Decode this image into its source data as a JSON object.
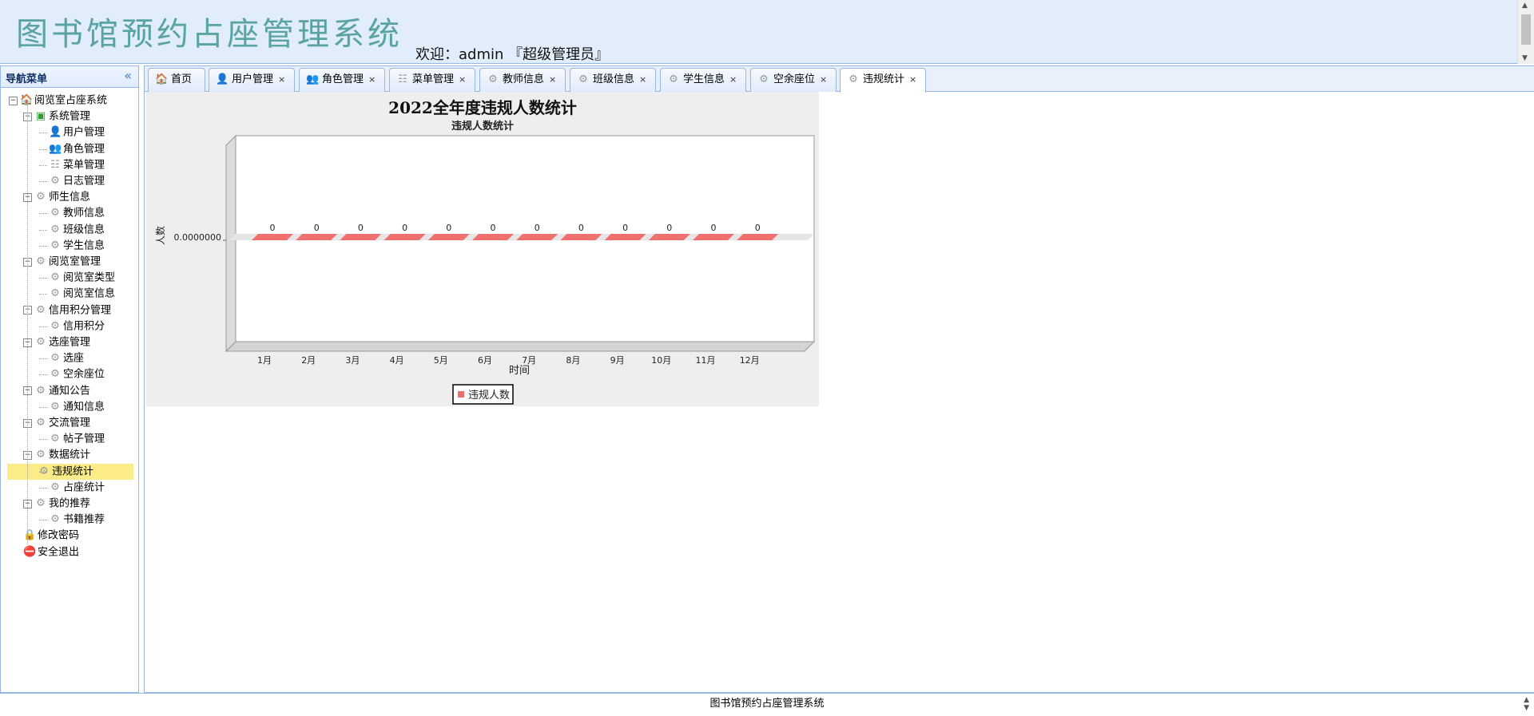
{
  "header": {
    "title": "图书馆预约占座管理系统",
    "welcome": "欢迎：admin 『超级管理员』"
  },
  "sidebar": {
    "title": "导航菜单",
    "tree": [
      {
        "label": "阅览室占座系统",
        "icon": "home-icon",
        "level": 0,
        "toggle": "⊟"
      },
      {
        "label": "系统管理",
        "icon": "green-square-icon",
        "level": 1,
        "toggle": "⊟"
      },
      {
        "label": "用户管理",
        "icon": "user-icon",
        "level": 2
      },
      {
        "label": "角色管理",
        "icon": "role-icon",
        "level": 2
      },
      {
        "label": "菜单管理",
        "icon": "menu-icon",
        "level": 2
      },
      {
        "label": "日志管理",
        "icon": "gear-icon",
        "level": 2
      },
      {
        "label": "师生信息",
        "icon": "gear-icon",
        "level": 1,
        "toggle": "⊟"
      },
      {
        "label": "教师信息",
        "icon": "gear-icon",
        "level": 2
      },
      {
        "label": "班级信息",
        "icon": "gear-icon",
        "level": 2
      },
      {
        "label": "学生信息",
        "icon": "gear-icon",
        "level": 2
      },
      {
        "label": "阅览室管理",
        "icon": "gear-icon",
        "level": 1,
        "toggle": "⊟"
      },
      {
        "label": "阅览室类型",
        "icon": "gear-icon",
        "level": 2
      },
      {
        "label": "阅览室信息",
        "icon": "gear-icon",
        "level": 2
      },
      {
        "label": "信用积分管理",
        "icon": "gear-icon",
        "level": 1,
        "toggle": "⊟"
      },
      {
        "label": "信用积分",
        "icon": "gear-icon",
        "level": 2
      },
      {
        "label": "选座管理",
        "icon": "gear-icon",
        "level": 1,
        "toggle": "⊟"
      },
      {
        "label": "选座",
        "icon": "gear-icon",
        "level": 2
      },
      {
        "label": "空余座位",
        "icon": "gear-icon",
        "level": 2
      },
      {
        "label": "通知公告",
        "icon": "gear-icon",
        "level": 1,
        "toggle": "⊟"
      },
      {
        "label": "通知信息",
        "icon": "gear-icon",
        "level": 2
      },
      {
        "label": "交流管理",
        "icon": "gear-icon",
        "level": 1,
        "toggle": "⊟"
      },
      {
        "label": "帖子管理",
        "icon": "gear-icon",
        "level": 2
      },
      {
        "label": "数据统计",
        "icon": "gear-icon",
        "level": 1,
        "toggle": "⊟"
      },
      {
        "label": "违规统计",
        "icon": "gear-icon",
        "level": 2,
        "selected": true
      },
      {
        "label": "占座统计",
        "icon": "gear-icon",
        "level": 2
      },
      {
        "label": "我的推荐",
        "icon": "gear-icon",
        "level": 1,
        "toggle": "⊟"
      },
      {
        "label": "书籍推荐",
        "icon": "gear-icon",
        "level": 2
      },
      {
        "label": "修改密码",
        "icon": "lock-icon",
        "level": 1
      },
      {
        "label": "安全退出",
        "icon": "exit-icon",
        "level": 1
      }
    ]
  },
  "tabs": [
    {
      "label": "首页",
      "icon": "home-icon",
      "closable": false
    },
    {
      "label": "用户管理",
      "icon": "user-icon",
      "closable": true
    },
    {
      "label": "角色管理",
      "icon": "role-icon",
      "closable": true
    },
    {
      "label": "菜单管理",
      "icon": "menu-icon",
      "closable": true
    },
    {
      "label": "教师信息",
      "icon": "gear-icon",
      "closable": true
    },
    {
      "label": "班级信息",
      "icon": "gear-icon",
      "closable": true
    },
    {
      "label": "学生信息",
      "icon": "gear-icon",
      "closable": true
    },
    {
      "label": "空余座位",
      "icon": "gear-icon",
      "closable": true
    },
    {
      "label": "违规统计",
      "icon": "gear-icon",
      "closable": true,
      "active": true
    }
  ],
  "chart_data": {
    "type": "bar",
    "title": "2022全年度违规人数统计",
    "subtitle": "违规人数统计",
    "xlabel": "时间",
    "ylabel": "人数",
    "y_tick_labels": [
      "0.0000000"
    ],
    "categories": [
      "1月",
      "2月",
      "3月",
      "4月",
      "5月",
      "6月",
      "7月",
      "8月",
      "9月",
      "10月",
      "11月",
      "12月"
    ],
    "series": [
      {
        "name": "违规人数",
        "values": [
          0,
          0,
          0,
          0,
          0,
          0,
          0,
          0,
          0,
          0,
          0,
          0
        ],
        "color": "#f07070"
      }
    ],
    "legend_position": "bottom",
    "grid": false
  },
  "footer": {
    "text": "图书馆预约占座管理系统"
  }
}
